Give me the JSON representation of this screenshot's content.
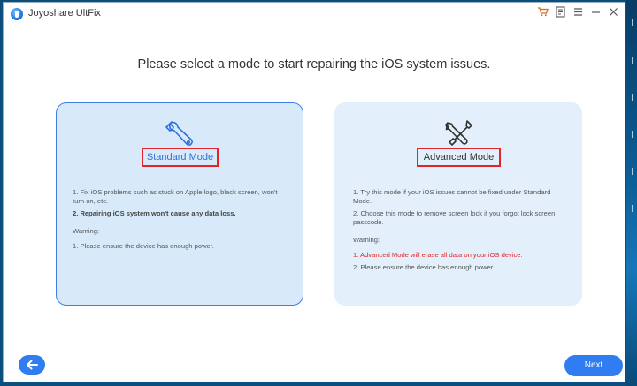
{
  "window": {
    "title": "Joyoshare UltFix",
    "titlebar_icons": [
      "cart-icon",
      "feedback-icon",
      "menu-icon",
      "minimize-icon",
      "close-icon"
    ]
  },
  "main": {
    "heading": "Please select a mode to start repairing the iOS system issues."
  },
  "standard_mode": {
    "label": "Standard Mode",
    "icon": "wrench-icon",
    "items": [
      "1. Fix iOS problems such as stuck on Apple logo, black screen, won't turn on, etc.",
      "2. Repairing iOS system won't cause any data loss."
    ],
    "warning_title": "Warning:",
    "warnings": [
      "1. Please ensure the device has enough power."
    ]
  },
  "advanced_mode": {
    "label": "Advanced Mode",
    "icon": "tools-icon",
    "items": [
      "1. Try this mode if your iOS issues cannot be fixed under Standard Mode.",
      "2. Choose this mode to remove screen lock if you forgot lock screen passcode."
    ],
    "warning_title": "Warning:",
    "warnings": [
      "1. Advanced Mode will erase all data on your iOS device.",
      "2. Please ensure the device has enough power."
    ]
  },
  "footer": {
    "back_icon": "arrow-left-icon",
    "next_label": "Next"
  },
  "colors": {
    "accent": "#2f7df0",
    "highlight_border": "#e0262b",
    "standard_card_bg": "#d8eafa",
    "advanced_card_bg": "#e3f0fb",
    "warning_text": "#e0262b"
  }
}
